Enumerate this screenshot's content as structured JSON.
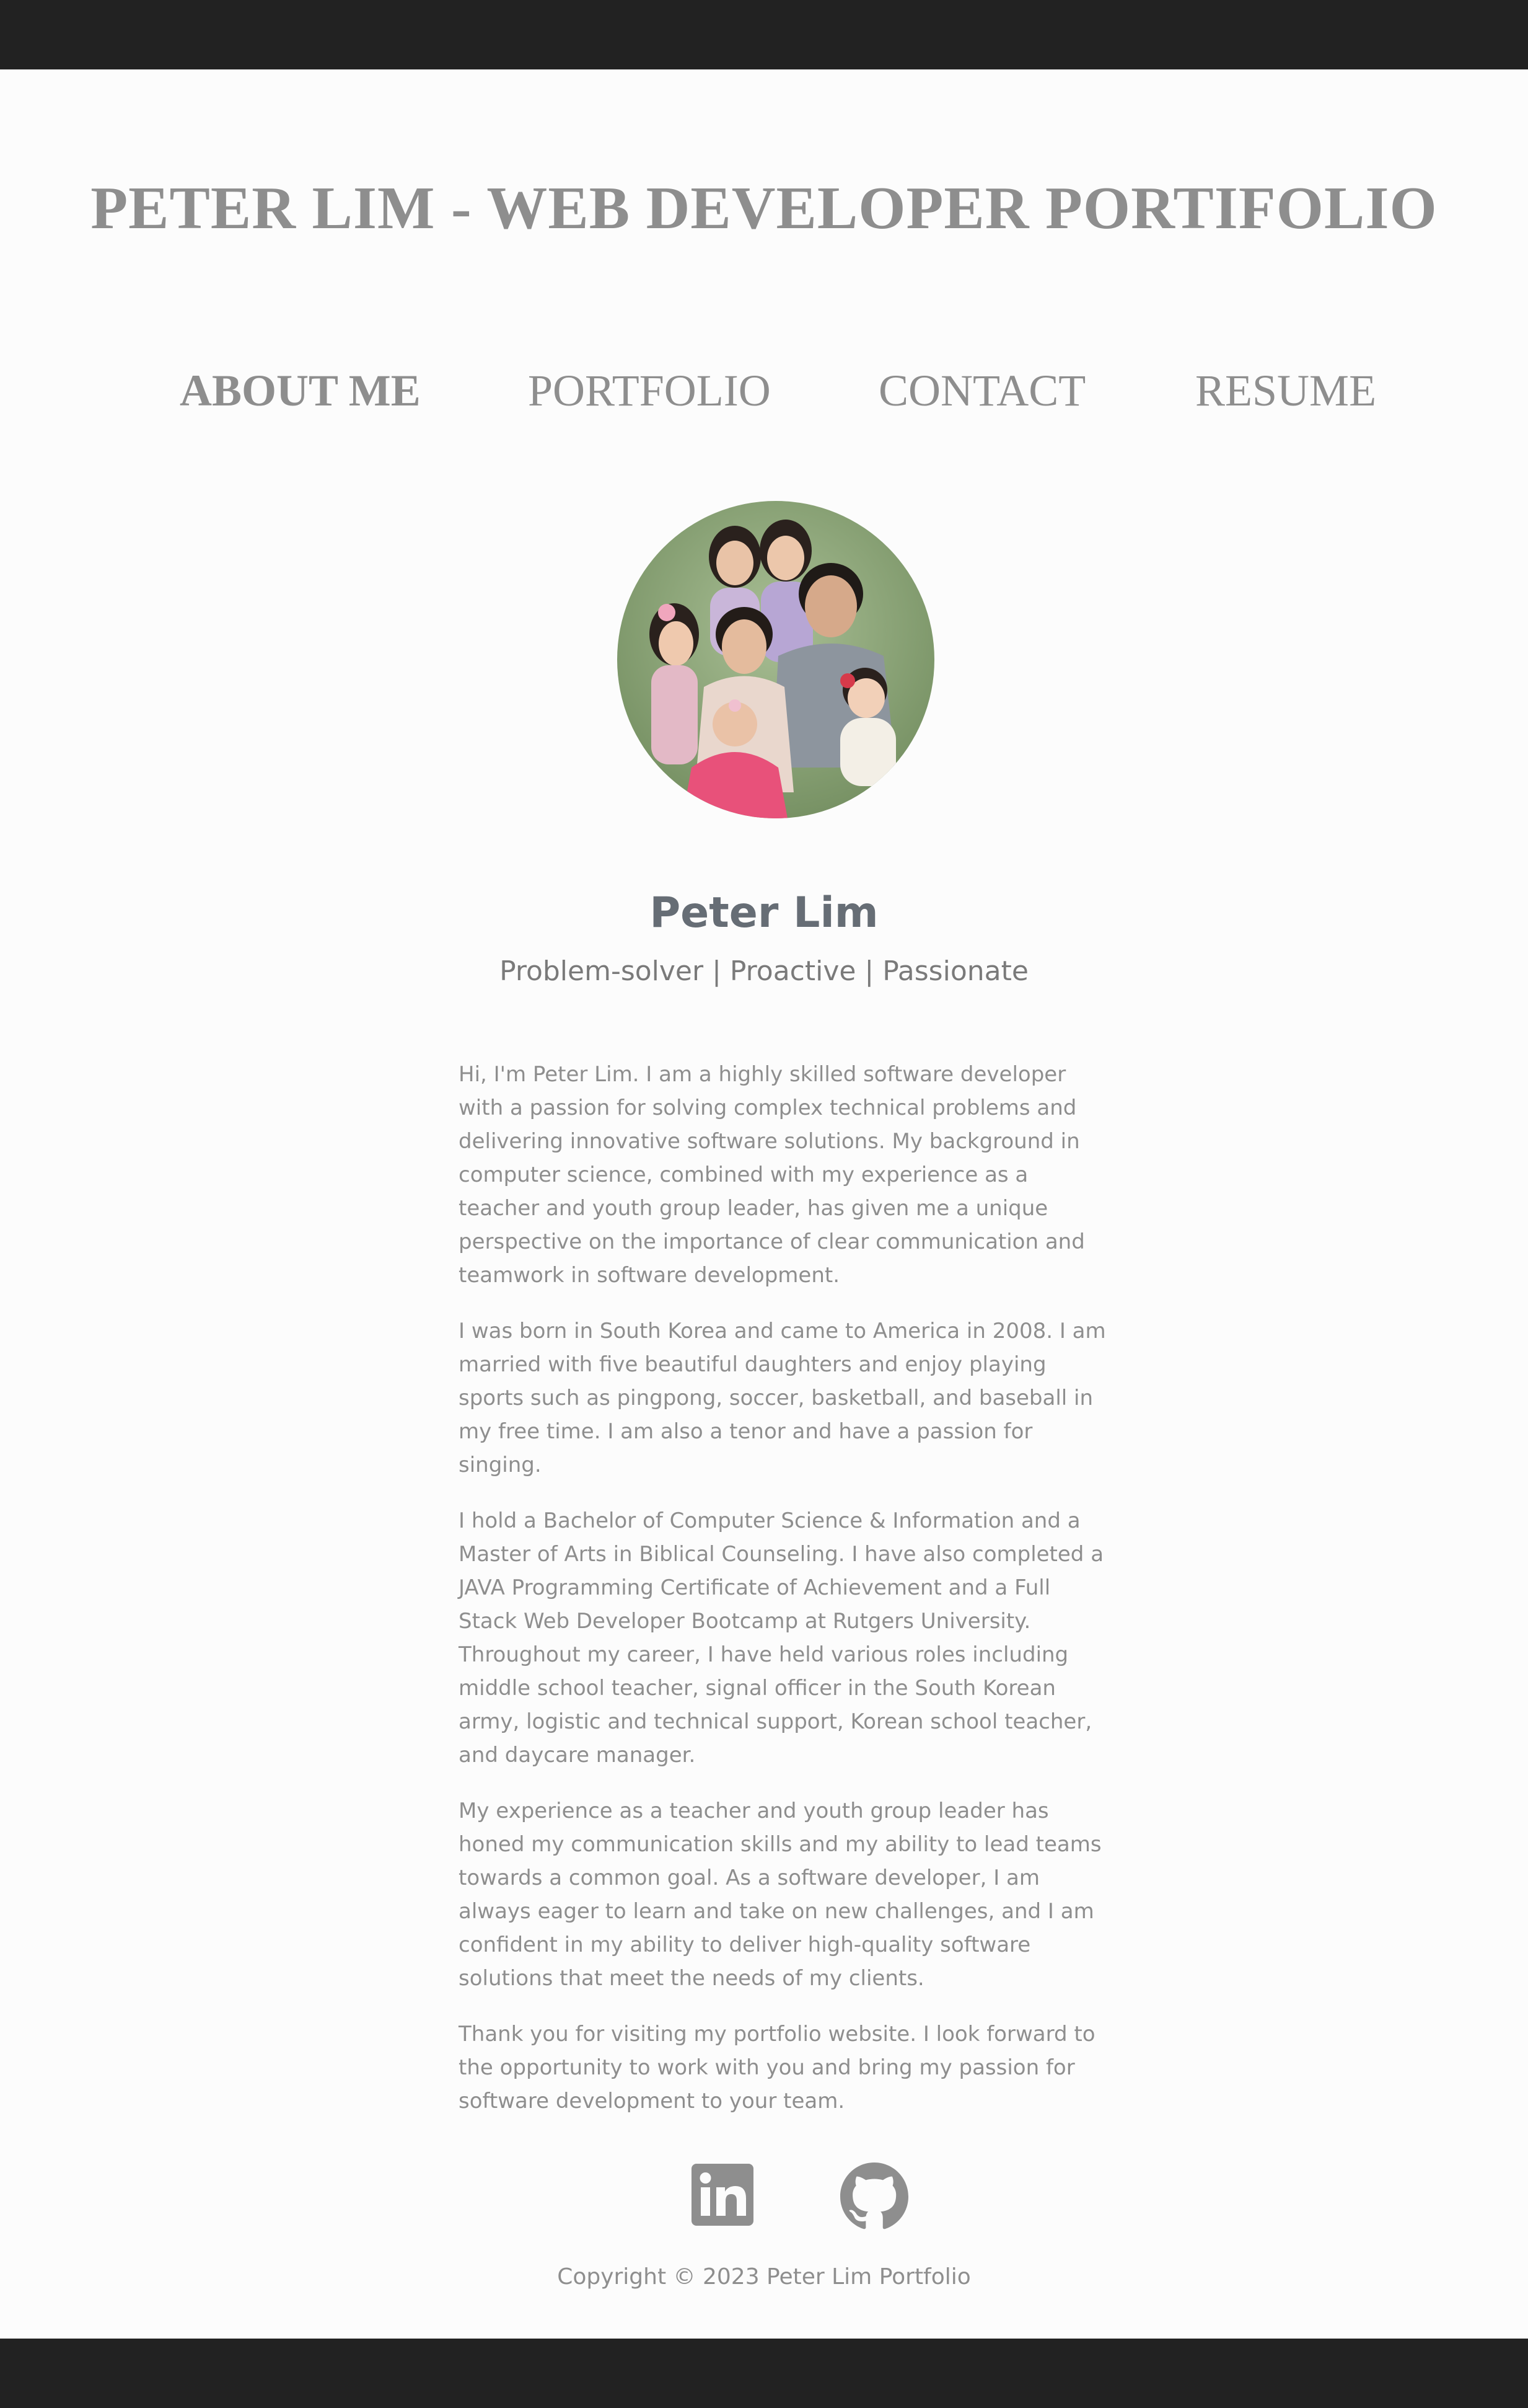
{
  "header": {
    "title": "PETER LIM - WEB DEVELOPER PORTIFOLIO"
  },
  "nav": {
    "items": [
      {
        "label": "ABOUT ME",
        "active": true
      },
      {
        "label": "PORTFOLIO",
        "active": false
      },
      {
        "label": "CONTACT",
        "active": false
      },
      {
        "label": "RESUME",
        "active": false
      }
    ]
  },
  "profile": {
    "name": "Peter Lim",
    "tagline": "Problem-solver | Proactive | Passionate",
    "photo_icon": "family-photo"
  },
  "bio": {
    "paragraphs": [
      "Hi, I'm Peter Lim. I am a highly skilled software developer with a passion for solving complex technical problems and delivering innovative software solutions. My background in computer science, combined with my experience as a teacher and youth group leader, has given me a unique perspective on the importance of clear communication and teamwork in software development.",
      "I was born in South Korea and came to America in 2008. I am married with five beautiful daughters and enjoy playing sports such as pingpong, soccer, basketball, and baseball in my free time. I am also a tenor and have a passion for singing.",
      "I hold a Bachelor of Computer Science & Information and a Master of Arts in Biblical Counseling. I have also completed a JAVA Programming Certificate of Achievement and a Full Stack Web Developer Bootcamp at Rutgers University. Throughout my career, I have held various roles including middle school teacher, signal officer in the South Korean army, logistic and technical support, Korean school teacher, and daycare manager.",
      "My experience as a teacher and youth group leader has honed my communication skills and my ability to lead teams towards a common goal. As a software developer, I am always eager to learn and take on new challenges, and I am confident in my ability to deliver high-quality software solutions that meet the needs of my clients.",
      "Thank you for visiting my portfolio website. I look forward to the opportunity to work with you and bring my passion for software development to your team."
    ]
  },
  "social": {
    "icons": [
      "linkedin-icon",
      "github-icon"
    ]
  },
  "footer": {
    "copyright": "Copyright © 2023 Peter Lim Portfolio"
  },
  "colors": {
    "bar": "#222222",
    "background": "#fcfcfc",
    "text": "#8e8e8e",
    "name": "#666d75"
  }
}
